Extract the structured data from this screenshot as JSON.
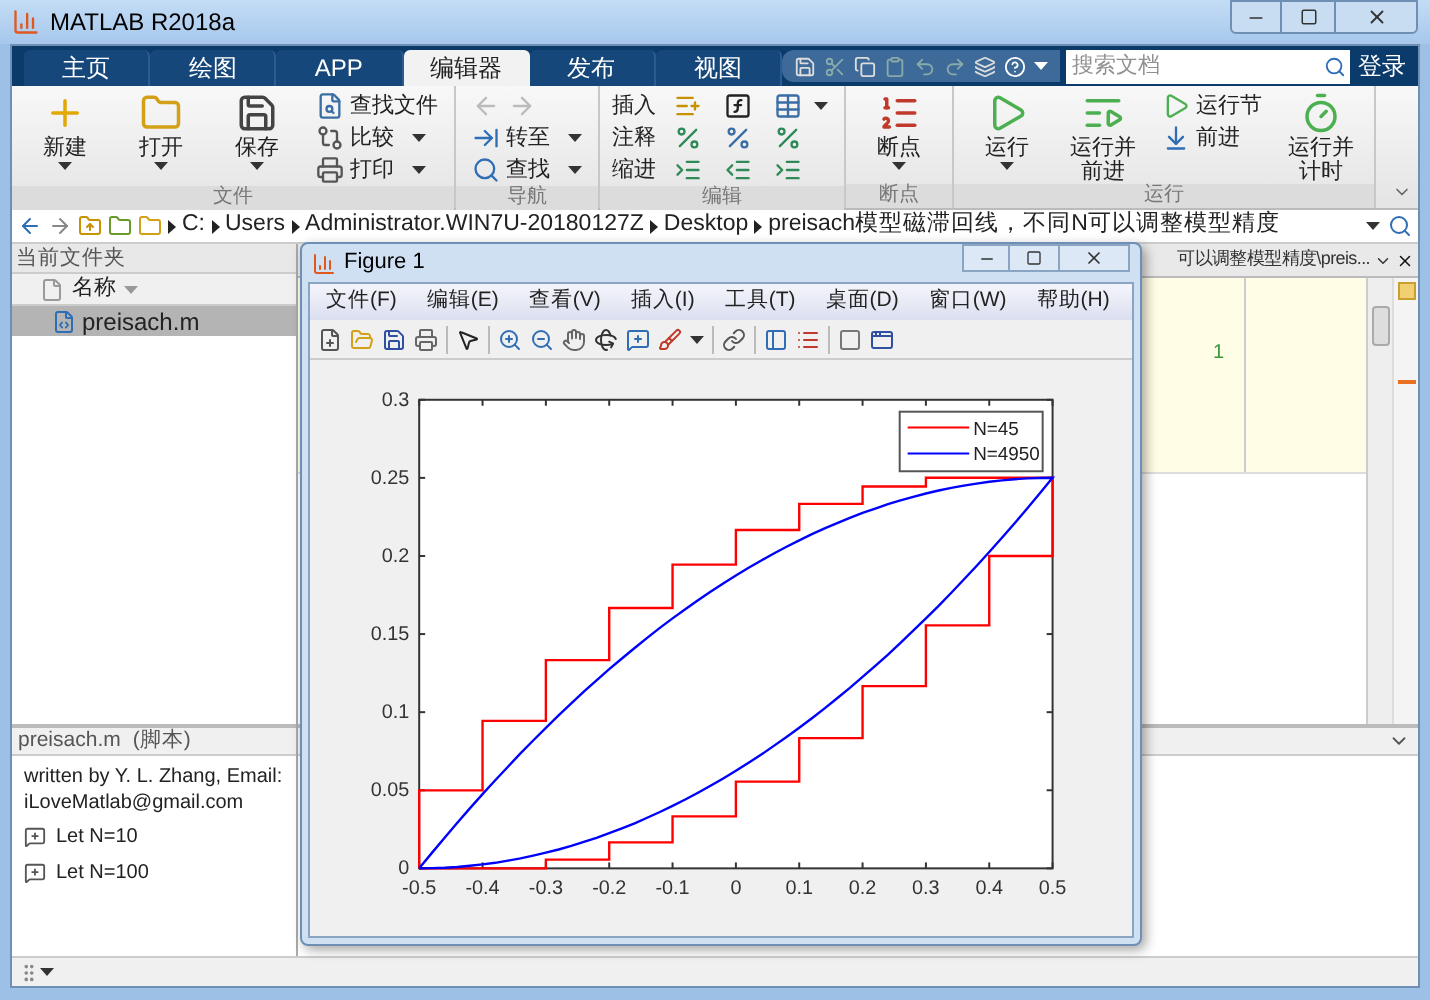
{
  "window": {
    "title": "MATLAB R2018a"
  },
  "ribbon": {
    "tabs": [
      {
        "label": "主页",
        "selected": false
      },
      {
        "label": "绘图",
        "selected": false
      },
      {
        "label": "APP",
        "selected": false
      },
      {
        "label": "编辑器",
        "selected": true
      },
      {
        "label": "发布",
        "selected": false
      },
      {
        "label": "视图",
        "selected": false
      }
    ],
    "groups": [
      {
        "label": "文件",
        "columns": [
          [
            {
              "kind": "large",
              "label": "新建",
              "dropdown": true
            }
          ],
          [
            {
              "kind": "large",
              "label": "打开",
              "dropdown": true
            }
          ],
          [
            {
              "kind": "large",
              "label": "保存",
              "dropdown": true
            }
          ],
          [
            {
              "kind": "small",
              "label": "查找文件",
              "dropdown": false
            },
            {
              "kind": "small",
              "label": "比较",
              "dropdown": true
            },
            {
              "kind": "small",
              "label": "打印",
              "dropdown": true
            }
          ]
        ]
      },
      {
        "label": "导航",
        "columns": [
          [
            {
              "kind": "arrows",
              "disabled": true
            },
            {
              "kind": "small",
              "label": "转至",
              "dropdown": true
            },
            {
              "kind": "small",
              "label": "查找",
              "dropdown": true
            }
          ]
        ]
      },
      {
        "label": "编辑",
        "columns": [
          [
            {
              "kind": "text",
              "label": "插入"
            },
            {
              "kind": "text",
              "label": "注释"
            },
            {
              "kind": "text",
              "label": "缩进"
            }
          ],
          [
            {
              "kind": "icon",
              "dropdown": false
            },
            {
              "kind": "icon",
              "dropdown": false
            },
            {
              "kind": "icon",
              "dropdown": false
            }
          ],
          [
            {
              "kind": "icon",
              "dropdown": false
            },
            {
              "kind": "icon",
              "dropdown": false
            },
            {
              "kind": "icon",
              "dropdown": false
            }
          ],
          [
            {
              "kind": "icon",
              "dropdown": true
            },
            {
              "kind": "icon",
              "dropdown": false
            },
            {
              "kind": "icon",
              "dropdown": false
            }
          ]
        ]
      },
      {
        "label": "断点",
        "columns": [
          [
            {
              "kind": "large",
              "label": "断点",
              "dropdown": true
            }
          ]
        ]
      },
      {
        "label": "运行",
        "columns": [
          [
            {
              "kind": "large",
              "label": "运行",
              "dropdown": true
            }
          ],
          [
            {
              "kind": "large",
              "label": "运行并前进",
              "dropdown": false
            }
          ],
          [
            {
              "kind": "small",
              "label": "运行节",
              "dropdown": false
            },
            {
              "kind": "small",
              "label": "前进",
              "dropdown": false
            }
          ],
          [
            {
              "kind": "large",
              "label": "运行并计时",
              "dropdown": false
            }
          ]
        ]
      }
    ]
  },
  "search": {
    "placeholder": "搜索文档"
  },
  "login": "登录",
  "address_bar": {
    "segments": [
      "C:",
      "Users",
      "Administrator.WIN7U-20180127Z",
      "Desktop",
      "preisach模型磁滞回线，不同N可以调整模型精度"
    ]
  },
  "current_folder": {
    "title": "当前文件夹",
    "column": "名称",
    "files": [
      {
        "name": "preisach.m",
        "selected": true
      }
    ]
  },
  "details": {
    "file": "preisach.m",
    "type": "(脚本)",
    "description": "written by Y. L. Zhang, Email: iLoveMatlab@gmail.com",
    "sections": [
      "Let N=10",
      "Let N=100"
    ]
  },
  "editor": {
    "tab_title": "可以调整模型精度\\preis...",
    "visible_text": "1"
  },
  "figure": {
    "title": "Figure 1",
    "menu": [
      "文件(F)",
      "编辑(E)",
      "查看(V)",
      "插入(I)",
      "工具(T)",
      "桌面(D)",
      "窗口(W)",
      "帮助(H)"
    ],
    "plot": {
      "x_tick_labels": [
        "-0.5",
        "-0.4",
        "-0.3",
        "-0.2",
        "-0.1",
        "0",
        "0.1",
        "0.2",
        "0.3",
        "0.4",
        "0.5"
      ],
      "y_tick_labels": [
        "0.3",
        "0.25",
        "0.2",
        "0.15",
        "0.1",
        "0.05",
        "0"
      ],
      "legend": [
        {
          "label": "N=45",
          "color": "#ff0000"
        },
        {
          "label": "N=4950",
          "color": "#0000ff"
        }
      ]
    }
  }
}
